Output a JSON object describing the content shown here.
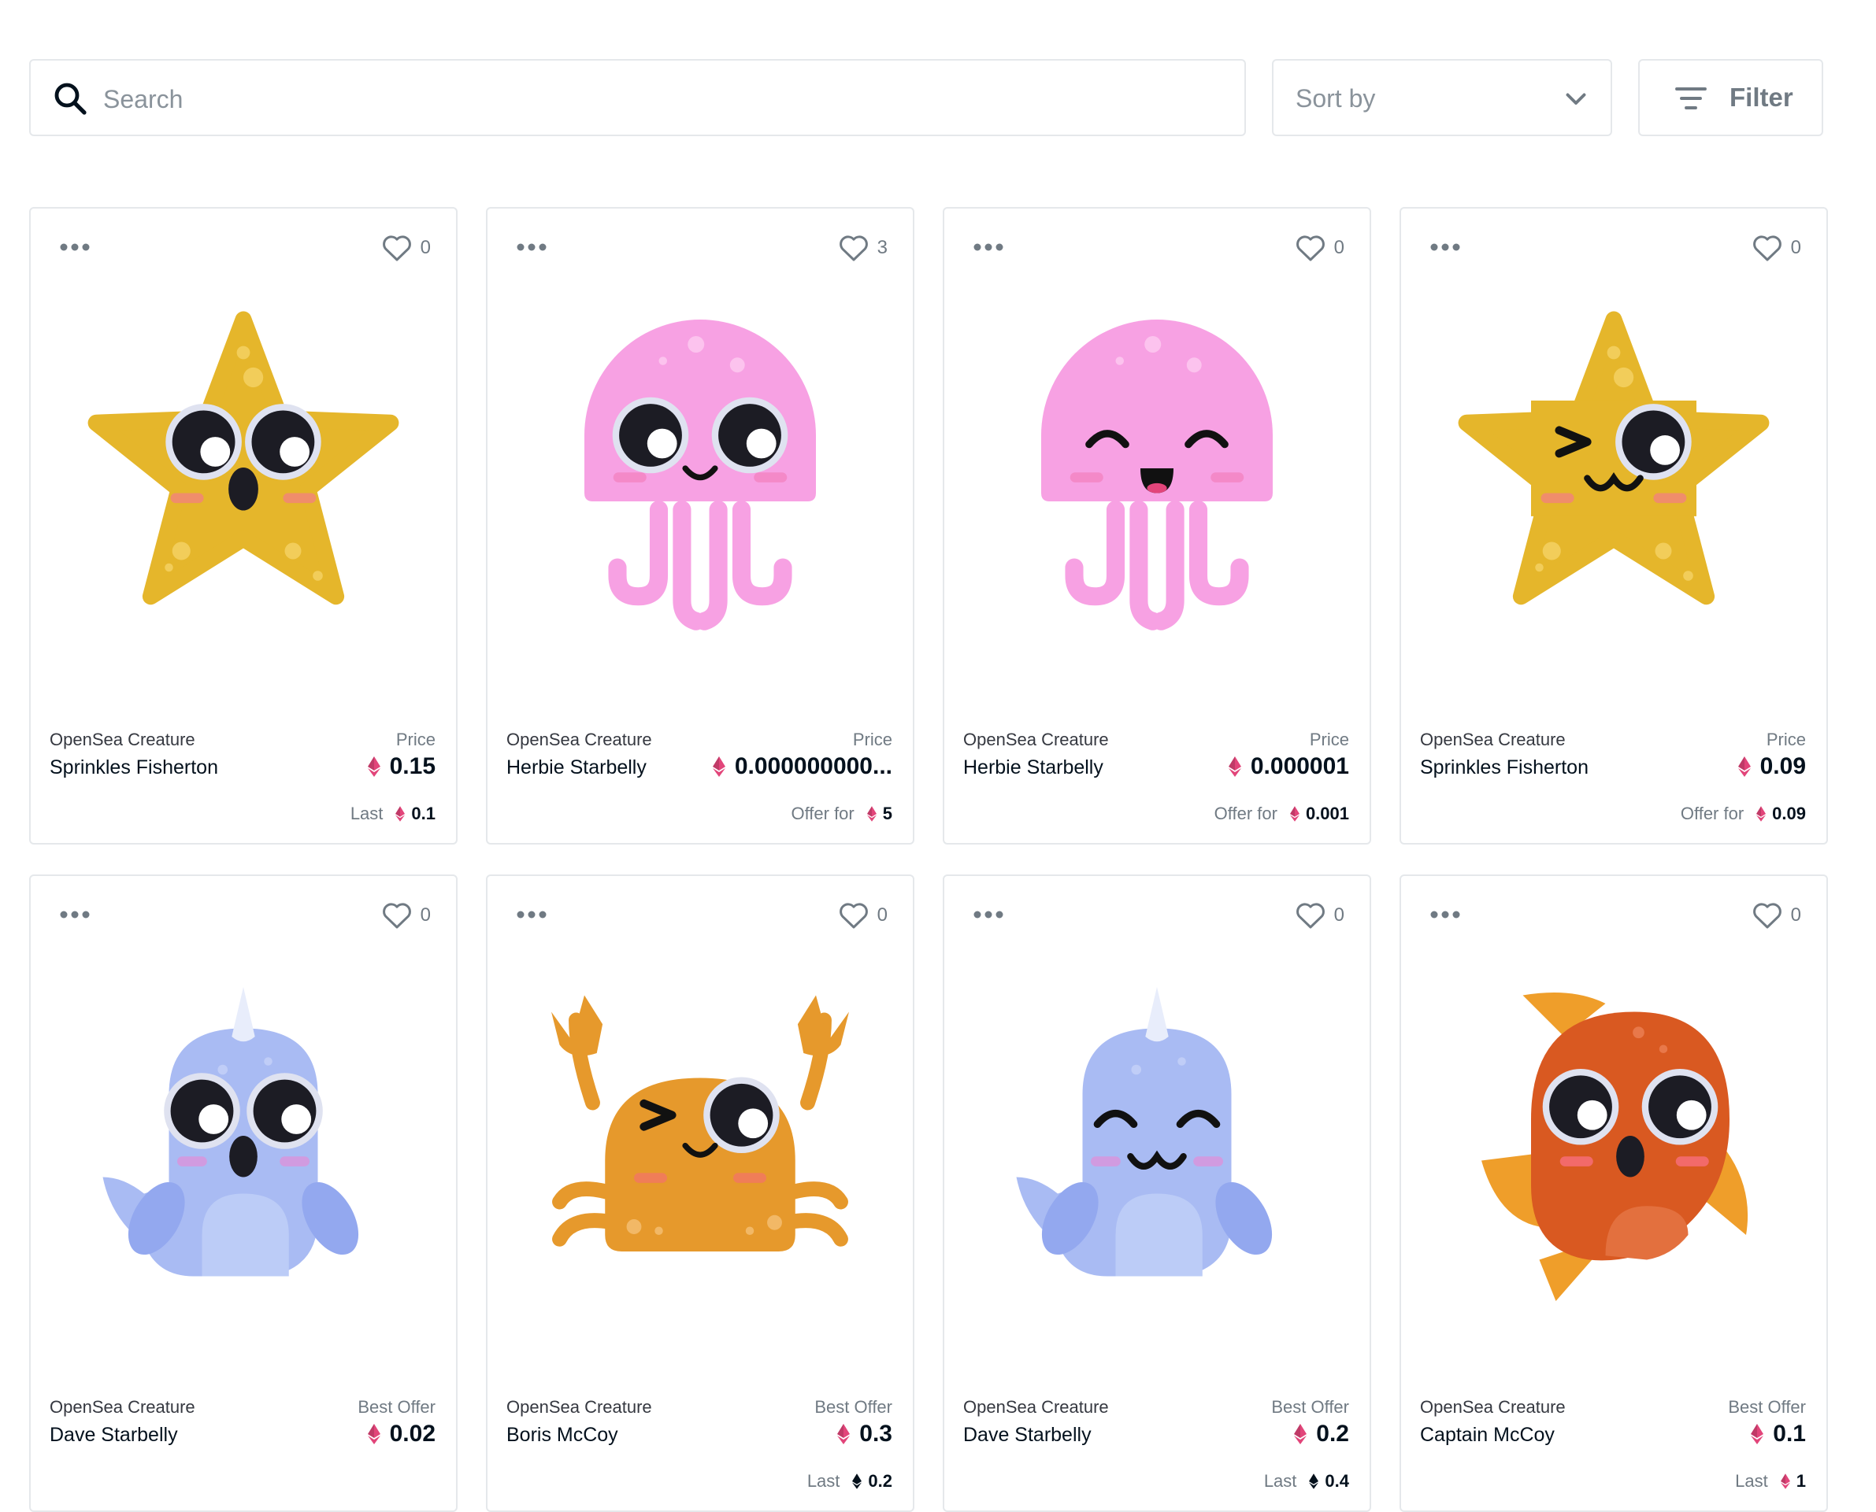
{
  "search": {
    "placeholder": "Search",
    "icon": "search-icon"
  },
  "sort": {
    "label": "Sort by",
    "icon": "chevron-down-icon"
  },
  "filter": {
    "label": "Filter",
    "icon": "filter-icon"
  },
  "colors": {
    "eth_pink": "#e2457a",
    "eth_dark": "#04111d",
    "border": "#e5e8eb",
    "muted": "#707a83"
  },
  "cards": [
    {
      "collection": "OpenSea Creature",
      "name": "Sprinkles Fisherton",
      "likes": "0",
      "price_label": "Price",
      "price": "0.15",
      "sub_label": "Last",
      "sub_value": "0.1",
      "sub_eth_color": "pink",
      "creature": "starfish"
    },
    {
      "collection": "OpenSea Creature",
      "name": "Herbie Starbelly",
      "likes": "3",
      "price_label": "Price",
      "price": "0.000000000...",
      "sub_label": "Offer for",
      "sub_value": "5",
      "sub_eth_color": "pink",
      "creature": "jellyfish"
    },
    {
      "collection": "OpenSea Creature",
      "name": "Herbie Starbelly",
      "likes": "0",
      "price_label": "Price",
      "price": "0.000001",
      "sub_label": "Offer for",
      "sub_value": "0.001",
      "sub_eth_color": "pink",
      "creature": "jellyfish"
    },
    {
      "collection": "OpenSea Creature",
      "name": "Sprinkles Fisherton",
      "likes": "0",
      "price_label": "Price",
      "price": "0.09",
      "sub_label": "Offer for",
      "sub_value": "0.09",
      "sub_eth_color": "pink",
      "creature": "starfish"
    },
    {
      "collection": "OpenSea Creature",
      "name": "Dave Starbelly",
      "likes": "0",
      "price_label": "Best Offer",
      "price": "0.02",
      "sub_label": "",
      "sub_value": "",
      "sub_eth_color": "",
      "creature": "narwhal"
    },
    {
      "collection": "OpenSea Creature",
      "name": "Boris McCoy",
      "likes": "0",
      "price_label": "Best Offer",
      "price": "0.3",
      "sub_label": "Last",
      "sub_value": "0.2",
      "sub_eth_color": "dark",
      "creature": "crab"
    },
    {
      "collection": "OpenSea Creature",
      "name": "Dave Starbelly",
      "likes": "0",
      "price_label": "Best Offer",
      "price": "0.2",
      "sub_label": "Last",
      "sub_value": "0.4",
      "sub_eth_color": "dark",
      "creature": "narwhal"
    },
    {
      "collection": "OpenSea Creature",
      "name": "Captain McCoy",
      "likes": "0",
      "price_label": "Best Offer",
      "price": "0.1",
      "sub_label": "Last",
      "sub_value": "1",
      "sub_eth_color": "pink",
      "creature": "fish"
    }
  ]
}
